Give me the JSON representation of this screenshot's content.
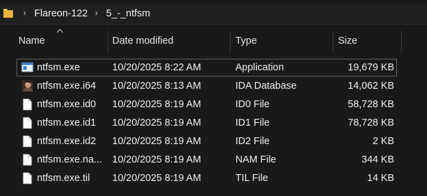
{
  "breadcrumb": {
    "items": [
      "Flareon-122",
      "5_-_ntfsm"
    ]
  },
  "columns": {
    "name": "Name",
    "date": "Date modified",
    "type": "Type",
    "size": "Size"
  },
  "files": [
    {
      "name": "ntfsm.exe",
      "date": "10/20/2025 8:22 AM",
      "type": "Application",
      "size": "19,679 KB",
      "icon": "application-icon"
    },
    {
      "name": "ntfsm.exe.i64",
      "date": "10/20/2025 8:13 AM",
      "type": "IDA Database",
      "size": "14,062 KB",
      "icon": "ida-database-icon"
    },
    {
      "name": "ntfsm.exe.id0",
      "date": "10/20/2025 8:19 AM",
      "type": "ID0 File",
      "size": "58,728 KB",
      "icon": "file-icon"
    },
    {
      "name": "ntfsm.exe.id1",
      "date": "10/20/2025 8:19 AM",
      "type": "ID1 File",
      "size": "78,728 KB",
      "icon": "file-icon"
    },
    {
      "name": "ntfsm.exe.id2",
      "date": "10/20/2025 8:19 AM",
      "type": "ID2 File",
      "size": "2 KB",
      "icon": "file-icon"
    },
    {
      "name": "ntfsm.exe.na...",
      "date": "10/20/2025 8:19 AM",
      "type": "NAM File",
      "size": "344 KB",
      "icon": "file-icon"
    },
    {
      "name": "ntfsm.exe.til",
      "date": "10/20/2025 8:19 AM",
      "type": "TIL File",
      "size": "14 KB",
      "icon": "file-icon"
    }
  ],
  "colors": {
    "background": "#191919",
    "folder": "#f2c14e",
    "application_blue": "#2f7dd6"
  }
}
